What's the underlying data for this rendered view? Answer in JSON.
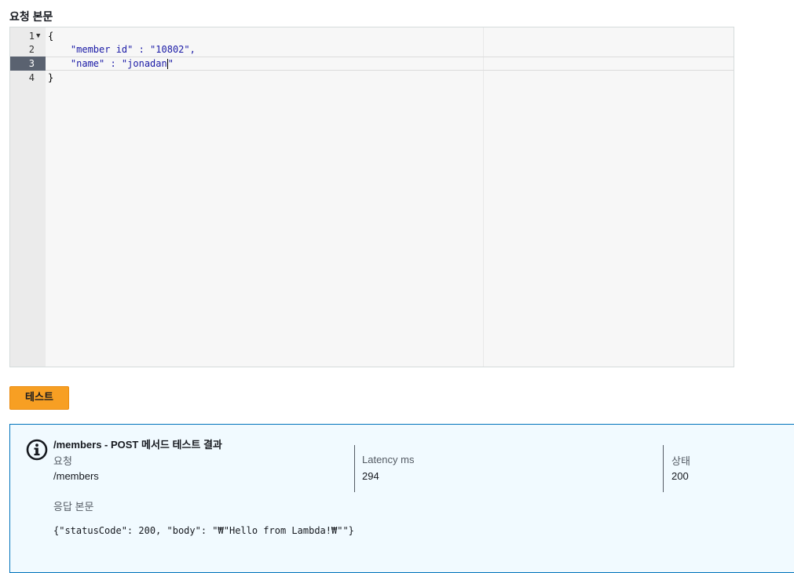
{
  "request_body": {
    "label": "요청 본문",
    "lines": [
      {
        "num": "1",
        "text": "{"
      },
      {
        "num": "2",
        "text": "    \"member id\" : \"10802\","
      },
      {
        "num": "3",
        "text_key": "    \"name\" : \"jonadan",
        "text_tail": "\""
      },
      {
        "num": "4",
        "text": "}"
      }
    ],
    "active_line": 3
  },
  "test_button": {
    "label": "테스트"
  },
  "result": {
    "title": "/members - POST 메서드 테스트 결과",
    "request_label": "요청",
    "request_value": "/members",
    "latency_label": "Latency ms",
    "latency_value": "294",
    "status_label": "상태",
    "status_value": "200",
    "response_label": "응답 본문",
    "response_body": "{\"statusCode\": 200, \"body\": \"₩\"Hello from Lambda!₩\"\"}"
  },
  "colors": {
    "accent": "#f79f23",
    "info_border": "#0073bb",
    "info_bg": "#f1faff"
  },
  "icons": {
    "info": "info-circle-icon",
    "fold": "fold-arrow-icon"
  }
}
